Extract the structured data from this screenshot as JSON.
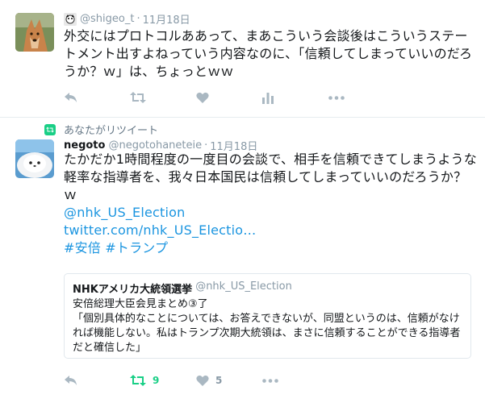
{
  "tweet1": {
    "handle": "@shigeo_t",
    "time": "11月18日",
    "text": "外交にはプロトコルああって、まあこういう会談後はこういうステートメント出すよねっていう内容なのに、「信頼してしまっていいのだろうか？ｗ」は、ちょっとｗｗ",
    "avatar_icon": "dog-avatar-icon"
  },
  "tweet2": {
    "retweet_context": "あなたがリツイート",
    "name": "negoto",
    "handle": "@negotohaneteie",
    "time": "11月18日",
    "text": "たかだか1時間程度の一度目の会談で、相手を信頼できてしまうような軽率な指導者を、我々日本国民は信頼してしまっていいのだろうか？ｗ",
    "links": {
      "mention": "@nhk_US_Election",
      "url": "twitter.com/nhk_US_Electio…",
      "hashtags": "#安倍 #トランプ"
    },
    "quote": {
      "name": "NHKアメリカ大統領選挙",
      "handle": "@nhk_US_Election",
      "text": "安倍総理大臣会見まとめ③了\n「個別具体的なことについては、お答えできないが、同盟というのは、信頼がなければ機能しない。私はトランプ次期大統領は、まさに信頼することができる指導者だと確信した」"
    },
    "retweet_count": "9",
    "like_count": "5",
    "avatar_icon": "seal-avatar-icon"
  },
  "colors": {
    "link": "#1b95e0",
    "retweet_green": "#19cf86",
    "muted": "#8899a6",
    "icon_grey": "#aab8c2"
  }
}
